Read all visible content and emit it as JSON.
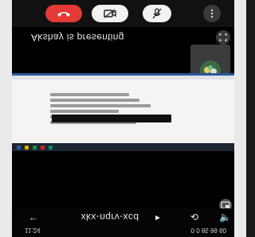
{
  "call_controls": {
    "end_call": "end-call",
    "camera": "camera-off",
    "mic": "mic-off",
    "more": "more-options"
  },
  "presenting_label": "Akshay is presenting",
  "shared_screen": {
    "doc_lines": [
      "",
      "",
      "",
      "",
      "",
      ""
    ]
  },
  "bottom_nav": {
    "url": "xkx-nqrv-xcd",
    "chevron": "▸",
    "back": "←",
    "rotate": "⟲",
    "speaker": "🔈"
  },
  "status_bar": {
    "time": "11:24",
    "right": "0 0 85 99 60"
  },
  "colors": {
    "end_call": "#e53935",
    "background": "#000000",
    "word_blue": "#2b579a"
  }
}
